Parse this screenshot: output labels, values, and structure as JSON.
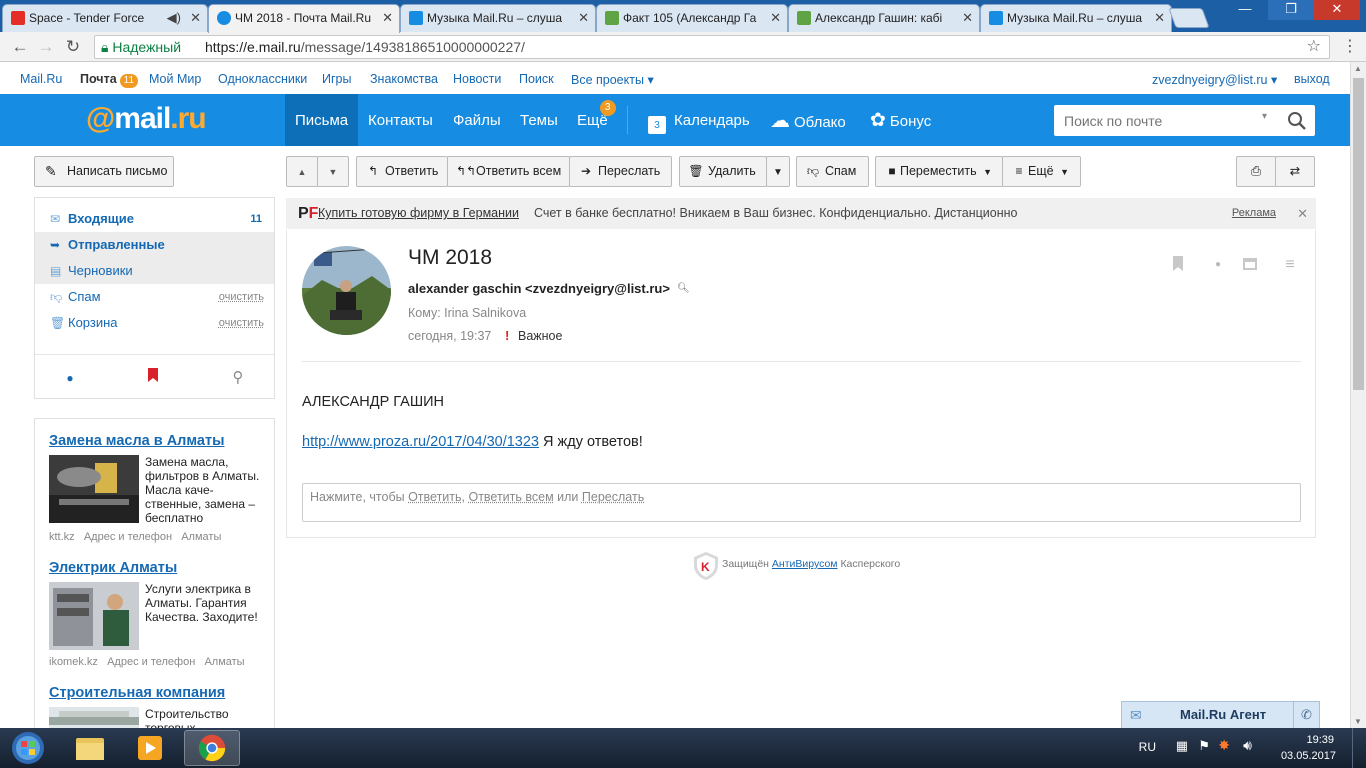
{
  "browser": {
    "tabs": [
      {
        "title": "Space - Tender Force",
        "icon_color": "#e52d27"
      },
      {
        "title": "ЧМ 2018 - Почта Mail.Ru",
        "icon_color": "#168de2"
      },
      {
        "title": "Музыка Mail.Ru – слуша",
        "icon_color": "#168de2"
      },
      {
        "title": "Факт 105 (Александр Га",
        "icon_color": "#5fa444"
      },
      {
        "title": "Александр Гашин: кабі",
        "icon_color": "#5fa444"
      },
      {
        "title": "Музыка Mail.Ru – слуша",
        "icon_color": "#168de2"
      }
    ],
    "secure_label": "Надежный",
    "url_domain": "https://e.mail.ru",
    "url_path": "/message/14938186510000000227/"
  },
  "portal": {
    "links": [
      "Mail.Ru",
      "Почта",
      "Мой Мир",
      "Одноклассники",
      "Игры",
      "Знакомства",
      "Новости",
      "Поиск",
      "Все проекты"
    ],
    "mail_badge": "11",
    "user": "zvezdnyeigry@list.ru",
    "logout": "выход"
  },
  "header": {
    "logo_at": "@",
    "logo_mail": "mail",
    "logo_ru": ".ru",
    "nav": [
      "Письма",
      "Контакты",
      "Файлы",
      "Темы",
      "Ещё"
    ],
    "more_badge": "3",
    "calendar": "Календарь",
    "calendar_day": "3",
    "cloud": "Облако",
    "bonus": "Бонус",
    "search_placeholder": "Поиск по почте"
  },
  "sidebar": {
    "compose": "Написать письмо",
    "folders": [
      {
        "label": "Входящие",
        "count": "11"
      },
      {
        "label": "Отправленные"
      },
      {
        "label": "Черновики"
      },
      {
        "label": "Спам",
        "action": "очистить"
      },
      {
        "label": "Корзина",
        "action": "очистить"
      }
    ]
  },
  "ads": [
    {
      "title": "Замена масла в Алматы",
      "text": "Замена масла, фильтров в Алматы. Масла каче-ственные, замена – бесплатно",
      "meta": [
        "ktt.kz",
        "Адрес и телефон",
        "Алматы"
      ]
    },
    {
      "title": "Электрик Алматы",
      "text": "Услуги электрика в Алматы. Гарантия Качества. Заходите!",
      "meta": [
        "ikomek.kz",
        "Адрес и телефон",
        "Алматы"
      ]
    },
    {
      "title": "Строительная компания",
      "text": "Строительство торговых",
      "meta": []
    }
  ],
  "toolbar": {
    "reply": "Ответить",
    "reply_all": "Ответить всем",
    "forward": "Переслать",
    "delete": "Удалить",
    "spam": "Спам",
    "move": "Переместить",
    "more": "Ещё"
  },
  "banner": {
    "logo_p": "P",
    "logo_f": "F",
    "link": "Купить готовую фирму в Германии",
    "text": "Счет в банке бесплатно! Вникаем в Ваш бизнес. Конфиденциально. Дистанционно",
    "ad_label": "Реклама"
  },
  "message": {
    "subject": "ЧМ 2018",
    "from": "alexander gaschin <zvezdnyeigry@list.ru>",
    "to": "Кому: Irina Salnikova",
    "date": "сегодня, 19:37",
    "important": "Важное",
    "body_line1": "АЛЕКСАНДР ГАШИН",
    "body_link": "http://www.proza.ru/2017/04/30/1323",
    "body_after": " Я жду ответов!",
    "reply_prompt": "Нажмите, чтобы",
    "reply_opt1": "Ответить",
    "reply_opt2": "Ответить всем",
    "reply_or": "или",
    "reply_opt3": "Переслать"
  },
  "kaspersky": {
    "prefix": "Защищён",
    "link": "АнтиВирусом",
    "suffix": "Касперского"
  },
  "agent": {
    "label": "Mail.Ru Агент"
  },
  "tray": {
    "lang": "RU",
    "time": "19:39",
    "date": "03.05.2017"
  }
}
